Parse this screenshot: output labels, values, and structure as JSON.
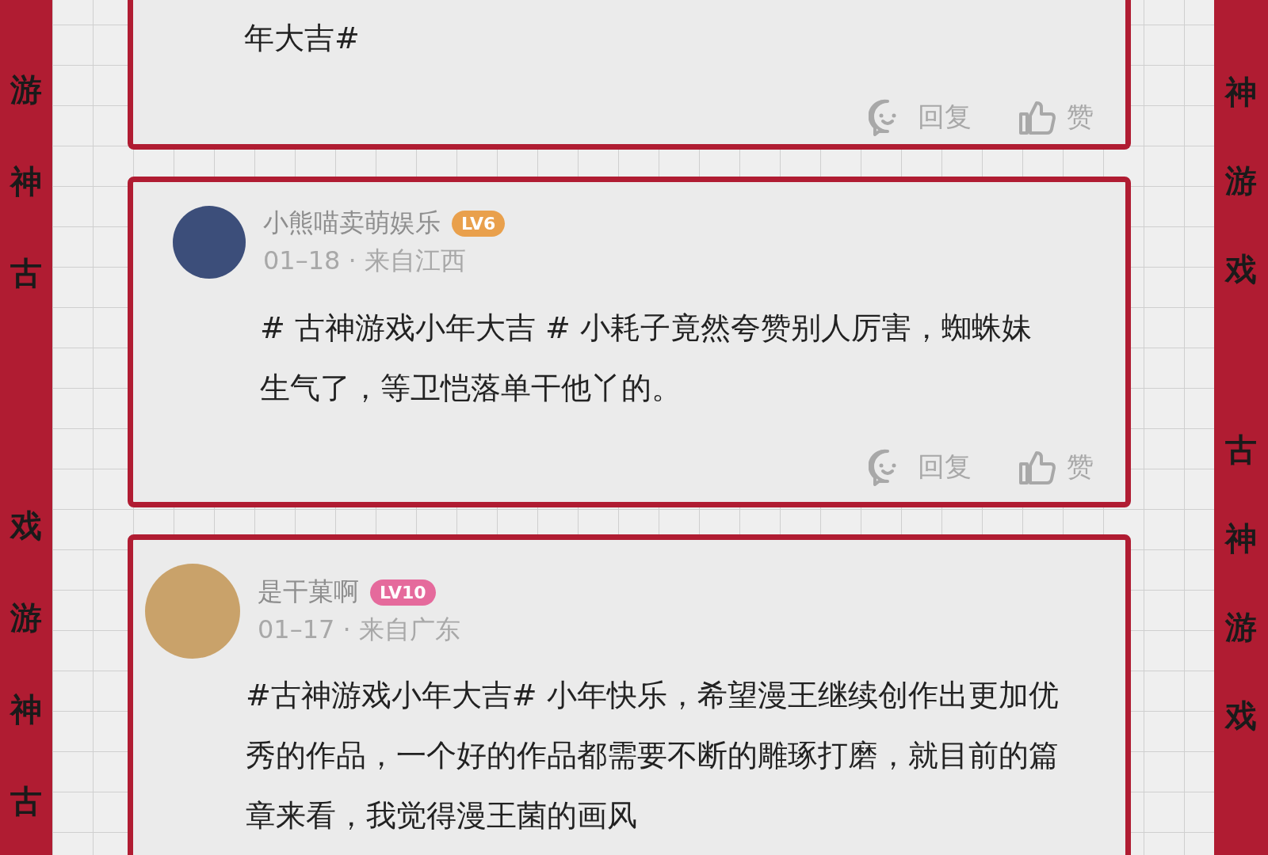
{
  "left_band": [
    "游神古",
    "戏游神古"
  ],
  "right_band": [
    "神游戏",
    "古神游戏"
  ],
  "comments": [
    {
      "body": "年大吉#",
      "actions": [
        {
          "kind": "reply",
          "label": "回复"
        },
        {
          "kind": "like",
          "label": "赞"
        }
      ]
    },
    {
      "user": {
        "name": "小熊喵卖萌娱乐",
        "level": "LV6",
        "color": "#e9a04c"
      },
      "meta": "01–18 · 来自江西",
      "body": " # 古神游戏小年大吉 # 小耗子竟然夸赞别人厉害，蜘蛛妹生气了，等卫恺落单干他丫的。",
      "actions": [
        {
          "kind": "reply",
          "label": "回复"
        },
        {
          "kind": "like",
          "label": "赞"
        }
      ]
    },
    {
      "user": {
        "name": "是干菓啊",
        "level": "LV10",
        "color": "#e56a9c"
      },
      "meta": "01–17 · 来自广东",
      "body": "#古神游戏小年大吉# 小年快乐，希望漫王继续创作出更加优秀的作品，一个好的作品都需要不断的雕琢打磨，就目前的篇章来看，我觉得漫王菌的画风"
    }
  ]
}
